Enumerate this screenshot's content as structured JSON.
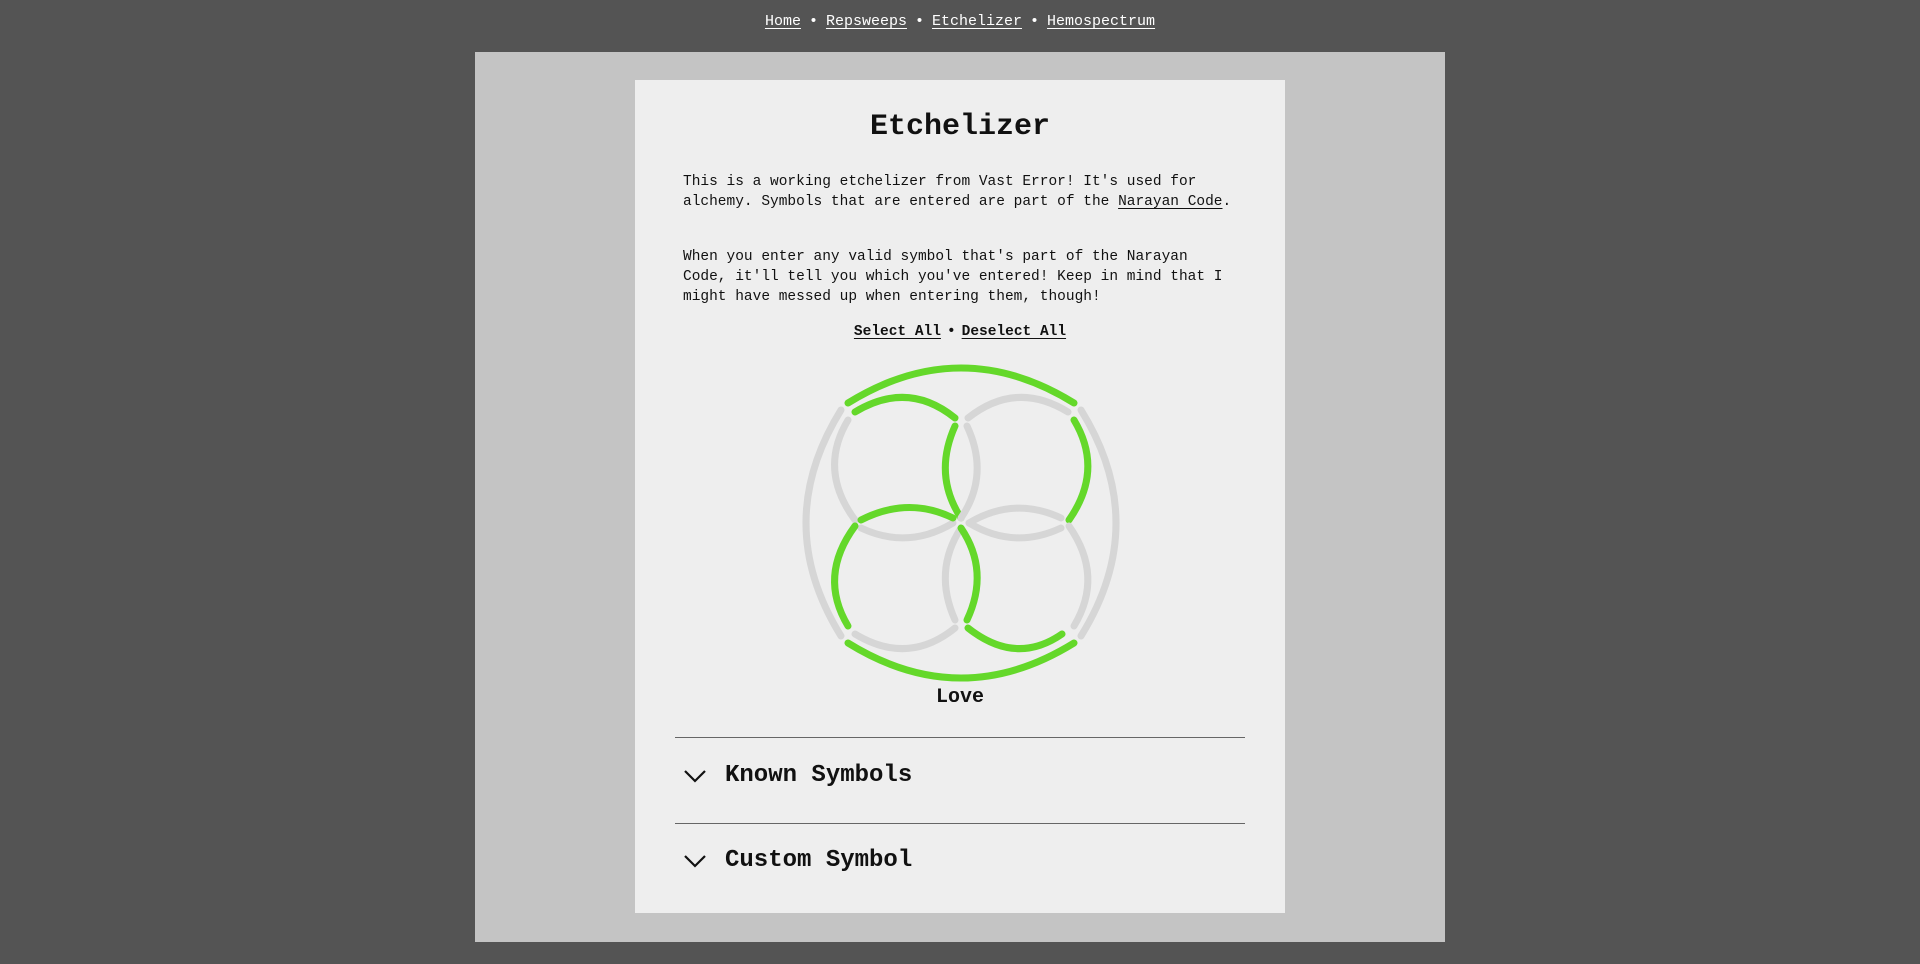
{
  "nav": {
    "items": [
      {
        "label": "Home"
      },
      {
        "label": "Repsweeps"
      },
      {
        "label": "Etchelizer"
      },
      {
        "label": "Hemospectrum"
      }
    ],
    "separator": "•"
  },
  "page": {
    "title": "Etchelizer",
    "intro": {
      "text_before": "This is a working etchelizer from Vast Error! It's used for alchemy. Symbols that are entered are part of the ",
      "link_label": "Narayan Code",
      "text_after": "."
    },
    "instructions": "When you enter any valid symbol that's part of the Narayan Code, it'll tell you which you've entered! Keep in mind that I might have messed up when entering them, though!",
    "select_all_label": "Select All",
    "deselect_all_label": "Deselect All",
    "select_separator": "•",
    "symbol_name": "Love"
  },
  "glyph": {
    "colors": {
      "active": "#64d82a",
      "inactive": "#d6d6d6"
    },
    "segments": [
      {
        "name": "outer-top",
        "active": true
      },
      {
        "name": "outer-right",
        "active": false
      },
      {
        "name": "outer-bottom",
        "active": true
      },
      {
        "name": "outer-left",
        "active": false
      },
      {
        "name": "tl-top",
        "active": true
      },
      {
        "name": "tl-left",
        "active": false
      },
      {
        "name": "tl-right",
        "active": true
      },
      {
        "name": "tl-bottom",
        "active": false
      },
      {
        "name": "tr-top",
        "active": false
      },
      {
        "name": "tr-left",
        "active": false
      },
      {
        "name": "tr-right",
        "active": true
      },
      {
        "name": "tr-bottom",
        "active": false
      },
      {
        "name": "bl-top",
        "active": true
      },
      {
        "name": "bl-left",
        "active": true
      },
      {
        "name": "bl-right",
        "active": false
      },
      {
        "name": "bl-bottom",
        "active": false
      },
      {
        "name": "br-top",
        "active": false
      },
      {
        "name": "br-left",
        "active": true
      },
      {
        "name": "br-right",
        "active": false
      },
      {
        "name": "br-bottom",
        "active": true
      }
    ]
  },
  "sections": [
    {
      "label": "Known Symbols",
      "icon": "chevron-down-icon"
    },
    {
      "label": "Custom Symbol",
      "icon": "chevron-down-icon"
    }
  ]
}
